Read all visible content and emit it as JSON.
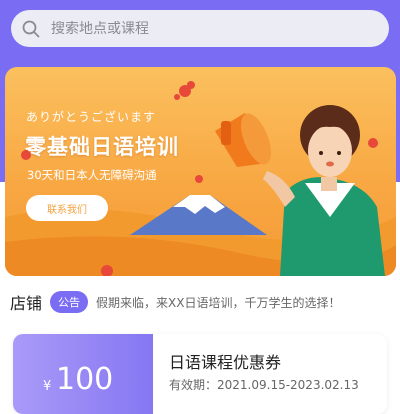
{
  "search": {
    "placeholder": "搜索地点或课程",
    "icon": "search-icon"
  },
  "banner": {
    "greeting": "ありがとうございます",
    "title": "零基础日语培训",
    "subtitle": "30天和日本人无障碍沟通",
    "button_label": "联系我们"
  },
  "notice": {
    "store_label": "店铺",
    "badge_label": "公告",
    "message": "假期来临，来XX日语培训，千万学生的选择！"
  },
  "coupon": {
    "currency": "¥",
    "amount": "100",
    "name": "日语课程优惠券",
    "validity": "有效期：2021.09.15-2023.02.13"
  },
  "colors": {
    "accent": "#7b6cf4",
    "banner_orange": "#f8a843",
    "coupon_purple": "#8577f2"
  }
}
